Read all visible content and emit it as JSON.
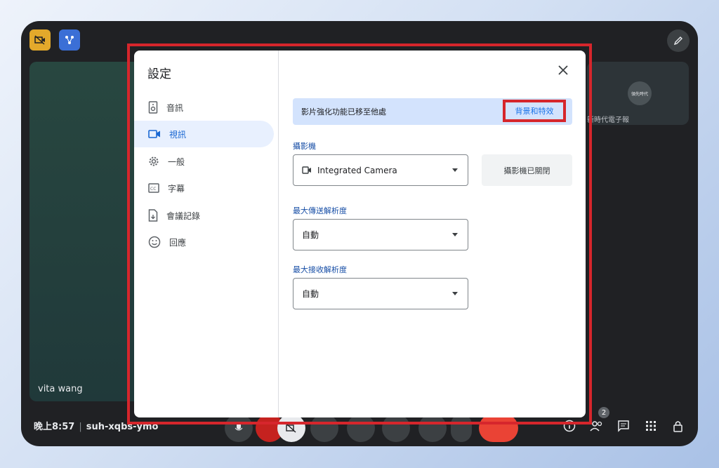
{
  "meeting": {
    "time": "晚上8:57",
    "separator": "|",
    "code": "suh-xqbs-ymo",
    "self_tile_name": "vita wang",
    "remote_tile_name": "新時代電子報",
    "remote_avatar_text": "領先時代",
    "participants_count": "2"
  },
  "settings": {
    "title": "設定",
    "nav": [
      {
        "label": "音訊",
        "icon": "speaker-icon"
      },
      {
        "label": "視訊",
        "icon": "videocam-icon"
      },
      {
        "label": "一般",
        "icon": "gear-icon"
      },
      {
        "label": "字幕",
        "icon": "captions-icon"
      },
      {
        "label": "會議記錄",
        "icon": "transcript-icon"
      },
      {
        "label": "回應",
        "icon": "emoji-icon"
      }
    ],
    "active_nav": "視訊",
    "banner_text": "影片強化功能已移至他處",
    "banner_link": "背景和特效",
    "camera_label": "攝影機",
    "camera_value": "Integrated Camera",
    "camera_off_button": "攝影機已關閉",
    "send_res_label": "最大傳送解析度",
    "send_res_value": "自動",
    "recv_res_label": "最大接收解析度",
    "recv_res_value": "自動"
  },
  "colors": {
    "highlight": "#d6262c",
    "accent_blue": "#1a73e8",
    "active_nav_bg": "#e8f0fe",
    "banner_bg": "#d3e3fd",
    "end_call": "#ea4335"
  }
}
